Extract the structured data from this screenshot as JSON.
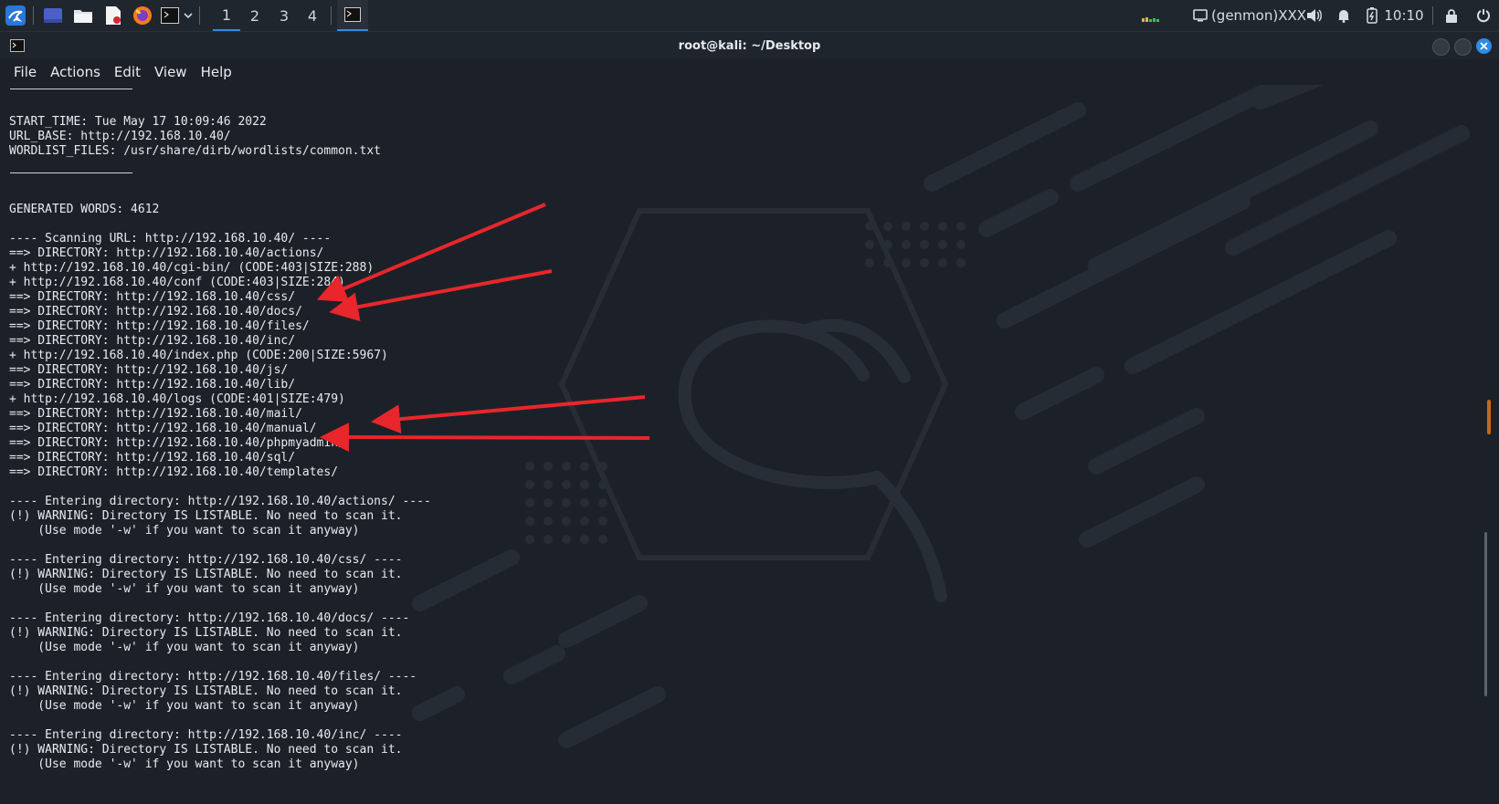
{
  "taskbar": {
    "workspaces": [
      "1",
      "2",
      "3",
      "4"
    ],
    "genmon": "(genmon)XXX",
    "clock": "10:10"
  },
  "window": {
    "title": "root@kali: ~/Desktop"
  },
  "menu": {
    "items": [
      "File",
      "Actions",
      "Edit",
      "View",
      "Help"
    ]
  },
  "terminal": {
    "lines": [
      "START_TIME: Tue May 17 10:09:46 2022",
      "URL_BASE: http://192.168.10.40/",
      "WORDLIST_FILES: /usr/share/dirb/wordlists/common.txt",
      "",
      "",
      "",
      "GENERATED WORDS: 4612",
      "",
      "---- Scanning URL: http://192.168.10.40/ ----",
      "==> DIRECTORY: http://192.168.10.40/actions/",
      "+ http://192.168.10.40/cgi-bin/ (CODE:403|SIZE:288)",
      "+ http://192.168.10.40/conf (CODE:403|SIZE:284)",
      "==> DIRECTORY: http://192.168.10.40/css/",
      "==> DIRECTORY: http://192.168.10.40/docs/",
      "==> DIRECTORY: http://192.168.10.40/files/",
      "==> DIRECTORY: http://192.168.10.40/inc/",
      "+ http://192.168.10.40/index.php (CODE:200|SIZE:5967)",
      "==> DIRECTORY: http://192.168.10.40/js/",
      "==> DIRECTORY: http://192.168.10.40/lib/",
      "+ http://192.168.10.40/logs (CODE:401|SIZE:479)",
      "==> DIRECTORY: http://192.168.10.40/mail/",
      "==> DIRECTORY: http://192.168.10.40/manual/",
      "==> DIRECTORY: http://192.168.10.40/phpmyadmin/",
      "==> DIRECTORY: http://192.168.10.40/sql/",
      "==> DIRECTORY: http://192.168.10.40/templates/",
      "",
      "---- Entering directory: http://192.168.10.40/actions/ ----",
      "(!) WARNING: Directory IS LISTABLE. No need to scan it.",
      "    (Use mode '-w' if you want to scan it anyway)",
      "",
      "---- Entering directory: http://192.168.10.40/css/ ----",
      "(!) WARNING: Directory IS LISTABLE. No need to scan it.",
      "    (Use mode '-w' if you want to scan it anyway)",
      "",
      "---- Entering directory: http://192.168.10.40/docs/ ----",
      "(!) WARNING: Directory IS LISTABLE. No need to scan it.",
      "    (Use mode '-w' if you want to scan it anyway)",
      "",
      "---- Entering directory: http://192.168.10.40/files/ ----",
      "(!) WARNING: Directory IS LISTABLE. No need to scan it.",
      "    (Use mode '-w' if you want to scan it anyway)",
      "",
      "---- Entering directory: http://192.168.10.40/inc/ ----",
      "(!) WARNING: Directory IS LISTABLE. No need to scan it.",
      "    (Use mode '-w' if you want to scan it anyway)"
    ]
  },
  "colors": {
    "annotation_arrow": "#e8262b",
    "accent": "#2f8ce0",
    "terminal_bg": "#1c2129"
  },
  "icons": {
    "app_menu": "kali-dragon-icon",
    "show_desktop": "desktop-icon",
    "file_manager": "folder-icon",
    "text_editor": "text-editor-icon",
    "browser": "firefox-icon",
    "terminal": "terminal-icon",
    "volume": "volume-icon",
    "notifications": "bell-icon",
    "battery": "battery-icon",
    "lock": "lock-icon",
    "logout": "power-icon"
  }
}
